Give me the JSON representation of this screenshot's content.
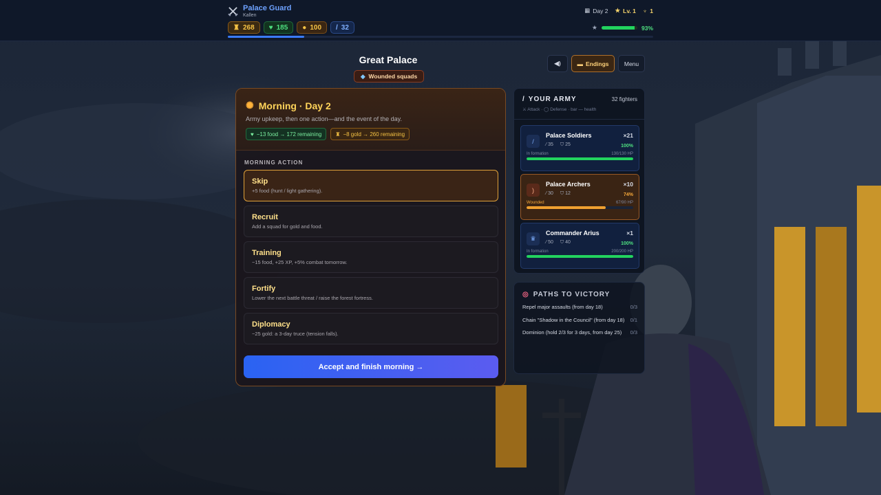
{
  "player": {
    "name": "Palace Guard",
    "subtitle": "Kallen"
  },
  "hud": {
    "day": "Day 2",
    "level": "Lv. 1",
    "trophies": "1"
  },
  "resources": {
    "gold": "268",
    "food": "185",
    "xp": "100",
    "power": "32"
  },
  "progress": {
    "fraction": 0.18
  },
  "morale": {
    "value": 0.93,
    "label": "93%"
  },
  "location": {
    "title": "Great Palace",
    "status": "Wounded squads"
  },
  "top_buttons": {
    "endings": "Endings",
    "menu": "Menu"
  },
  "phase": {
    "title": "Morning · Day 2",
    "description": "Army upkeep, then one action—and the event of the day.",
    "food_upkeep": "−13 food → 172 remaining",
    "gold_upkeep": "−8 gold → 260 remaining",
    "section_label": "MORNING ACTION",
    "actions": [
      {
        "title": "Skip",
        "desc": "+5 food (hunt / light gathering)."
      },
      {
        "title": "Recruit",
        "desc": "Add a squad for gold and food."
      },
      {
        "title": "Training",
        "desc": "−15 food, +25 XP, +5% combat tomorrow."
      },
      {
        "title": "Fortify",
        "desc": "Lower the next battle threat / raise the forest fortress."
      },
      {
        "title": "Diplomacy",
        "desc": "−25 gold: a 3-day truce (tension falls)."
      }
    ],
    "accept": "Accept and finish morning →"
  },
  "army": {
    "title": "YOUR ARMY",
    "count": "32 fighters",
    "legend": "⚔ Attack · ◯ Defense · bar — health",
    "units": [
      {
        "name": "Palace Soldiers",
        "qty": "×21",
        "attack": "35",
        "defense": "25",
        "pct": "100%",
        "status": "In formation",
        "hp": "130/130 HP",
        "health": 1.0
      },
      {
        "name": "Palace Archers",
        "qty": "×10",
        "attack": "30",
        "defense": "12",
        "pct": "74%",
        "status": "Wounded",
        "hp": "67/90 HP",
        "health": 0.74
      },
      {
        "name": "Commander Arius",
        "qty": "×1",
        "attack": "50",
        "defense": "40",
        "pct": "100%",
        "status": "In formation",
        "hp": "200/200 HP",
        "health": 1.0
      }
    ]
  },
  "paths": {
    "title": "PATHS TO VICTORY",
    "items": [
      {
        "label": "Repel major assaults (from day 18)",
        "progress": "0/3"
      },
      {
        "label": "Chain \"Shadow in the Council\" (from day 18)",
        "progress": "0/1"
      },
      {
        "label": "Dominion (hold 2/3 for 3 days, from day 25)",
        "progress": "0/3"
      }
    ]
  },
  "colors": {
    "accent": "#3a7bff",
    "gold": "#f6c344",
    "food": "#4ee080",
    "panel_border": "#7a4a22"
  }
}
